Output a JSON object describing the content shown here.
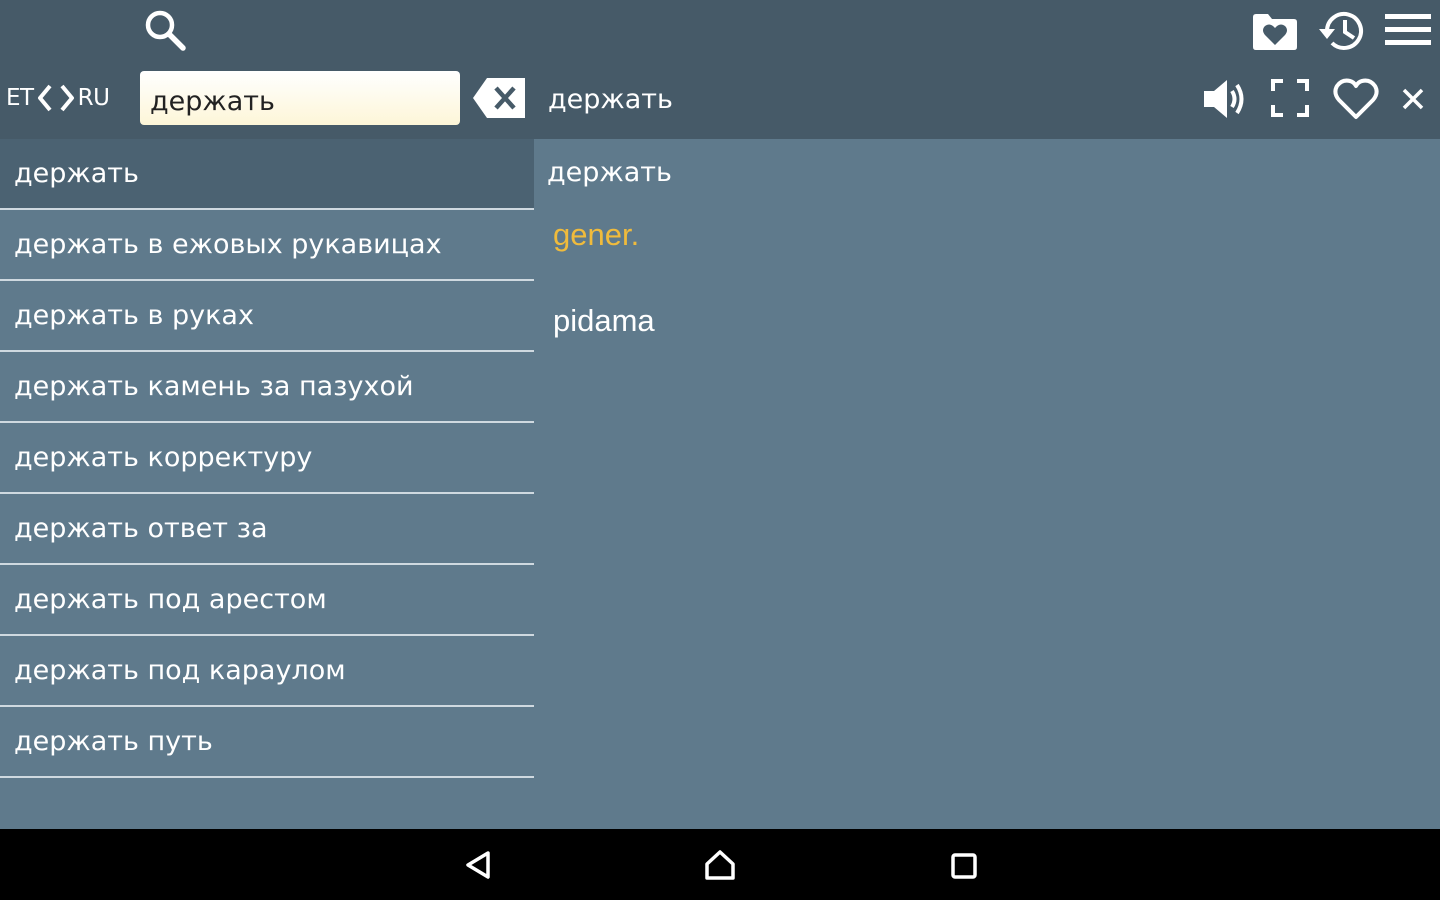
{
  "toolbar": {
    "icons": [
      "search-icon",
      "favorites-folder-icon",
      "history-icon",
      "menu-icon"
    ],
    "source_lang": "ET",
    "target_lang": "RU",
    "search_value": "держать",
    "current_word": "держать",
    "action_icons": [
      "clear-icon",
      "speaker-icon",
      "fullscreen-icon",
      "heart-icon",
      "close-icon"
    ]
  },
  "list": {
    "items": [
      {
        "label": "держать",
        "selected": true
      },
      {
        "label": "держать в ежовых рукавицах"
      },
      {
        "label": "держать в руках"
      },
      {
        "label": "держать камень за пазухой"
      },
      {
        "label": "держать корректуру"
      },
      {
        "label": "держать ответ за"
      },
      {
        "label": "держать под арестом"
      },
      {
        "label": "держать под караулом"
      },
      {
        "label": "держать путь"
      }
    ]
  },
  "detail": {
    "headword": "держать",
    "subject_label": "gener.",
    "translation": "pidama"
  },
  "navbar": {
    "icons": [
      "back-icon",
      "home-icon",
      "recents-icon"
    ]
  },
  "colors": {
    "toolbar_bg": "#465a68",
    "content_bg": "#5f7a8c",
    "selected_item_bg": "#4b6272",
    "divider": "#cfd9e0",
    "label_accent": "#f0bb3c",
    "navbar_bg": "#000000"
  }
}
